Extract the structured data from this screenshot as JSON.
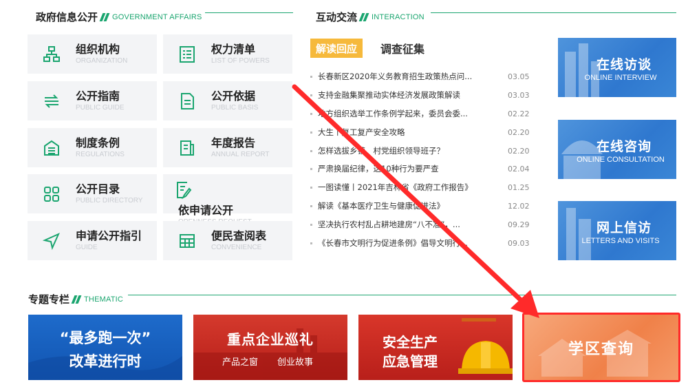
{
  "gov": {
    "title": "政府信息公开",
    "title_en": "GOVERNMENT AFFAIRS",
    "tiles": [
      {
        "cn": "组织机构",
        "en": "ORGANIZATION",
        "icon": "org-chart-icon"
      },
      {
        "cn": "权力清单",
        "en": "LIST OF POWERS",
        "icon": "list-icon"
      },
      {
        "cn": "公开指南",
        "en": "PUBLIC GUIDE",
        "icon": "guide-arrows-icon"
      },
      {
        "cn": "公开依据",
        "en": "PUBLIC BASIS",
        "icon": "document-icon"
      },
      {
        "cn": "制度条例",
        "en": "REGULATIONS",
        "icon": "regulations-icon"
      },
      {
        "cn": "年度报告",
        "en": "ANNUAL REPORT",
        "icon": "report-icon"
      },
      {
        "cn": "公开目录",
        "en": "PUBLIC DIRECTORY",
        "icon": "grid-icon"
      },
      {
        "cn": "依申请公开",
        "en": "OPENNESS REQUEST",
        "icon": "edit-document-icon"
      },
      {
        "cn": "申请公开指引",
        "en": "GUIDE",
        "icon": "navigation-icon"
      },
      {
        "cn": "便民查阅表",
        "en": "CONVENIENCE",
        "icon": "table-icon"
      }
    ]
  },
  "interaction": {
    "title": "互动交流",
    "title_en": "INTERACTION",
    "tabs": [
      "解读回应",
      "调查征集"
    ],
    "news": [
      {
        "title": "长春新区2020年义务教育招生政策热点问...",
        "date": "03.05"
      },
      {
        "title": "支持金融集聚推动实体经济发展政策解读",
        "date": "03.03"
      },
      {
        "title": "地方组织选举工作条例学起来，委员会委...",
        "date": "02.22"
      },
      {
        "title": "大生丨复工复产安全攻略",
        "date": "02.20"
      },
      {
        "title": "怎样选拔乡镇、村党组织领导班子？",
        "date": "02.20"
      },
      {
        "title": "严肃换届纪律，这10种行为要严查",
        "date": "02.04"
      },
      {
        "title": "一图读懂丨2021年吉林省《政府工作报告》",
        "date": "01.25"
      },
      {
        "title": "解读《基本医疗卫生与健康促进法》",
        "date": "12.02"
      },
      {
        "title": "坚决执行农村乱占耕地建房“八不准”，...",
        "date": "09.29"
      },
      {
        "title": "《长春市文明行为促进条例》倡导文明行...",
        "date": "09.03"
      }
    ],
    "buttons": [
      {
        "cn": "在线访谈",
        "en": "ONLINE INTERVIEW"
      },
      {
        "cn": "在线咨询",
        "en": "ONLINE CONSULTATION"
      },
      {
        "cn": "网上信访",
        "en": "LETTERS AND VISITS"
      }
    ]
  },
  "thematic": {
    "title": "专题专栏",
    "title_en": "THEMATIC",
    "banners": [
      {
        "line1": "“最多跑一次”",
        "line2": "改革进行时"
      },
      {
        "line1": "重点企业巡礼",
        "sub1": "产品之窗",
        "sub2": "创业故事"
      },
      {
        "line1": "安全生产",
        "line2": "应急管理"
      },
      {
        "line1": "学区查询"
      }
    ]
  },
  "colors": {
    "accent": "#1aa56f",
    "tab_active": "#f6b93b",
    "annotation": "#ff2a2a"
  }
}
